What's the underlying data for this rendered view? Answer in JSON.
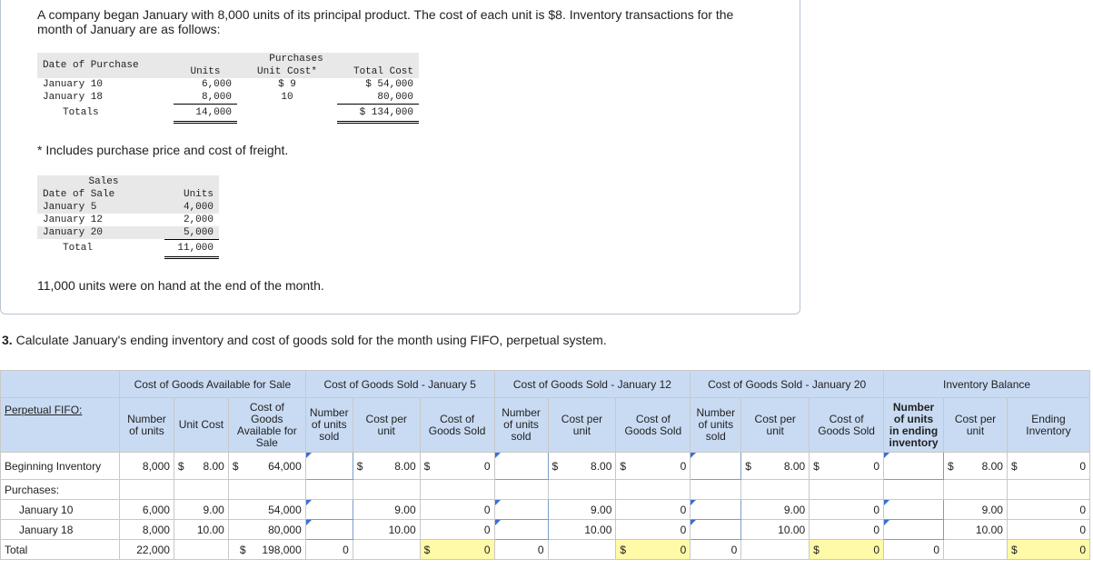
{
  "intro": "A company began January with 8,000 units of its principal product. The cost of each unit is $8. Inventory transactions for the month of January are as follows:",
  "purchases_table": {
    "group_header": "Purchases",
    "col_date": "Date of Purchase",
    "col_units": "Units",
    "col_unit_cost": "Unit Cost*",
    "col_total": "Total Cost",
    "rows": [
      {
        "date": "January 10",
        "units": "6,000",
        "unit_cost": "$ 9",
        "total": "$ 54,000"
      },
      {
        "date": "January 18",
        "units": "8,000",
        "unit_cost": "10",
        "total": "80,000"
      }
    ],
    "totals_label": "Totals",
    "totals_units": "14,000",
    "totals_cost": "$ 134,000"
  },
  "footnote": "* Includes purchase price and cost of freight.",
  "sales_table": {
    "group_header": "Sales",
    "col_date": "Date of Sale",
    "col_units": "Units",
    "rows": [
      {
        "date": "January 5",
        "units": "4,000"
      },
      {
        "date": "January 12",
        "units": "2,000"
      },
      {
        "date": "January 20",
        "units": "5,000"
      }
    ],
    "total_label": "Total",
    "total_units": "11,000"
  },
  "on_hand": "11,000 units were on hand at the end of the month.",
  "question_num": "3.",
  "question_text": " Calculate January's ending inventory and cost of goods sold for the month using FIFO, perpetual system.",
  "worksheet": {
    "groups": {
      "available": "Cost of Goods Available for Sale",
      "jan5": "Cost of Goods Sold - January 5",
      "jan12": "Cost of Goods Sold - January 12",
      "jan20": "Cost of Goods Sold - January 20",
      "balance": "Inventory Balance"
    },
    "perpetual_link": "Perpetual FIFO:",
    "sub": {
      "num_units": "Number of units",
      "unit_cost": "Unit Cost",
      "cogas": "Cost of Goods Available for Sale",
      "num_sold": "Number of units sold",
      "cost_per_unit": "Cost per unit",
      "cogs": "Cost of Goods Sold",
      "num_ending": "Number of units in ending inventory",
      "ending_inv": "Ending Inventory"
    },
    "rows": {
      "beginning": {
        "label": "Beginning Inventory",
        "units": "8,000",
        "cost": "8.00",
        "total": "64,000",
        "cpu": "8.00",
        "cogs": "0",
        "end": "0"
      },
      "purchases_label": "Purchases:",
      "jan10": {
        "label": "January 10",
        "units": "6,000",
        "cost": "9.00",
        "total": "54,000",
        "cpu": "9.00",
        "cogs": "0",
        "end": "0"
      },
      "jan18": {
        "label": "January 18",
        "units": "8,000",
        "cost": "10.00",
        "total": "80,000",
        "cpu": "10.00",
        "cogs": "0",
        "end": "0"
      },
      "total": {
        "label": "Total",
        "units": "22,000",
        "total": "198,000",
        "sold": "0",
        "cogs": "0",
        "end": "0"
      }
    },
    "dollar": "$"
  }
}
